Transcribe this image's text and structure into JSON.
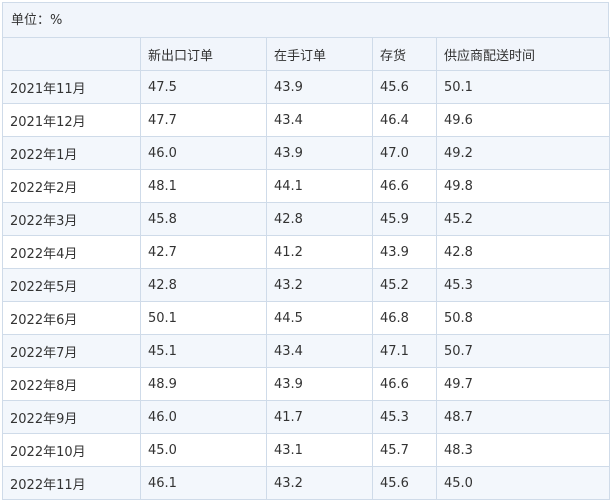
{
  "unit_label": "单位：%",
  "table": {
    "headers": [
      "",
      "新出口订单",
      "在手订单",
      "存货",
      "供应商配送时间"
    ],
    "rows": [
      [
        "2021年11月",
        "47.5",
        "43.9",
        "45.6",
        "50.1"
      ],
      [
        "2021年12月",
        "47.7",
        "43.4",
        "46.4",
        "49.6"
      ],
      [
        "2022年1月",
        "46.0",
        "43.9",
        "47.0",
        "49.2"
      ],
      [
        "2022年2月",
        "48.1",
        "44.1",
        "46.6",
        "49.8"
      ],
      [
        "2022年3月",
        "45.8",
        "42.8",
        "45.9",
        "45.2"
      ],
      [
        "2022年4月",
        "42.7",
        "41.2",
        "43.9",
        "42.8"
      ],
      [
        "2022年5月",
        "42.8",
        "43.2",
        "45.2",
        "45.3"
      ],
      [
        "2022年6月",
        "50.1",
        "44.5",
        "46.8",
        "50.8"
      ],
      [
        "2022年7月",
        "45.1",
        "43.4",
        "47.1",
        "50.7"
      ],
      [
        "2022年8月",
        "48.9",
        "43.9",
        "46.6",
        "49.7"
      ],
      [
        "2022年9月",
        "46.0",
        "41.7",
        "45.3",
        "48.7"
      ],
      [
        "2022年10月",
        "45.0",
        "43.1",
        "45.7",
        "48.3"
      ],
      [
        "2022年11月",
        "46.1",
        "43.2",
        "45.6",
        "45.0"
      ]
    ]
  }
}
